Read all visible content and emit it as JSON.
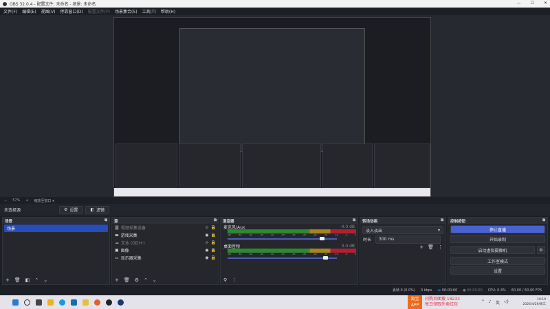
{
  "title": "OBS 32.0.4 - 配置文件: 未命名 - 场景: 未命名",
  "menu": [
    {
      "label": "文件(F)"
    },
    {
      "label": "编辑(E)"
    },
    {
      "label": "视图(V)"
    },
    {
      "label": "停靠窗口(D)"
    },
    {
      "label": "配置文件(P)",
      "disabled": true
    },
    {
      "label": "场景集合(S)"
    },
    {
      "label": "工具(T)"
    },
    {
      "label": "帮助(H)"
    }
  ],
  "zoom": {
    "minus": "−",
    "value": "57%",
    "plus": "+",
    "fit": "缩放至窗口"
  },
  "sourcebar": {
    "none": "未选择源",
    "settings": "设置",
    "filters": "滤镜"
  },
  "scenes": {
    "title": "场景",
    "items": [
      "场景"
    ]
  },
  "sources": {
    "title": "源",
    "items": [
      {
        "label": "视频采集设备",
        "icon": "camera-icon",
        "visible": false
      },
      {
        "label": "游戏采集",
        "icon": "gamepad-icon",
        "visible": true
      },
      {
        "label": "文本 (GDI+)",
        "icon": "text-icon",
        "visible": false
      },
      {
        "label": "图像",
        "icon": "image-icon",
        "visible": true
      },
      {
        "label": "显示器采集",
        "icon": "monitor-icon",
        "visible": true
      }
    ]
  },
  "mixer": {
    "title": "混音器",
    "channels": [
      {
        "name": "麦克风/Aux",
        "db": "-4.0 dB",
        "volume": 0.87
      },
      {
        "name": "桌面音频",
        "db": "3.0 dB",
        "volume": 0.9
      }
    ],
    "ticks": [
      "-60",
      "-55",
      "-50",
      "-45",
      "-40",
      "-35",
      "-30",
      "-25",
      "-20",
      "-15",
      "-10",
      "-5",
      "0"
    ]
  },
  "transitions": {
    "title": "转场动画",
    "selected": "淡入淡出",
    "duration_label": "时长",
    "duration": "300 ms"
  },
  "controls": {
    "title": "控制按钮",
    "stream": "停止直播",
    "record": "开始录制",
    "virtualcam": "启动虚拟摄像机",
    "studio": "工作室模式",
    "settings": "设置",
    "accent": "#4a62d0"
  },
  "status": {
    "frames": "丢帧 0 (0.0%)",
    "kbps": "0 kbps",
    "stream_time": "00:00:00",
    "rec_time": "00:00:00",
    "cpu": "CPU: 0.4%",
    "fps": "60.00 / 60.00 FPS"
  },
  "taskbar": {
    "ad_brand": "淘宝 APP",
    "ad_line1": "闪购页面搜 18233",
    "ad_line2": "每日领取外卖红包",
    "time": "19:19",
    "date": "2026/4/29/周三",
    "lang": "英"
  }
}
